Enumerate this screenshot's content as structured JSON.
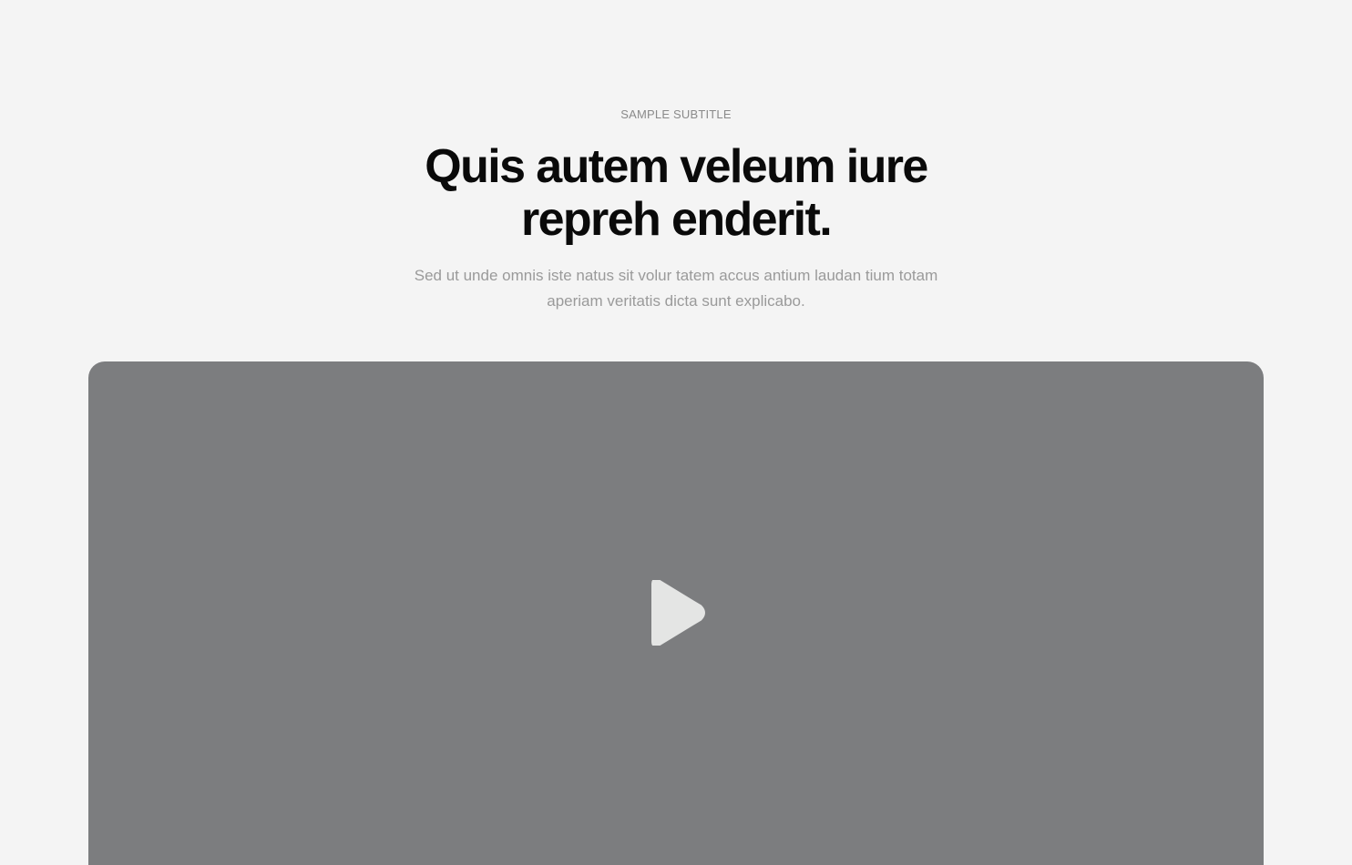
{
  "hero": {
    "subtitle": "SAMPLE SUBTITLE",
    "title": "Quis autem veleum iure repreh enderit.",
    "description": "Sed ut unde omnis iste natus sit volur tatem accus antium laudan tium totam aperiam veritatis dicta sunt explicabo."
  },
  "video": {
    "icon": "play-icon",
    "colors": {
      "background": "#7c7d7f",
      "play_icon": "#e4e5e4"
    }
  },
  "colors": {
    "page_background": "#f4f4f4",
    "title": "#0a0a0a",
    "muted_text": "#9a9a9a"
  }
}
